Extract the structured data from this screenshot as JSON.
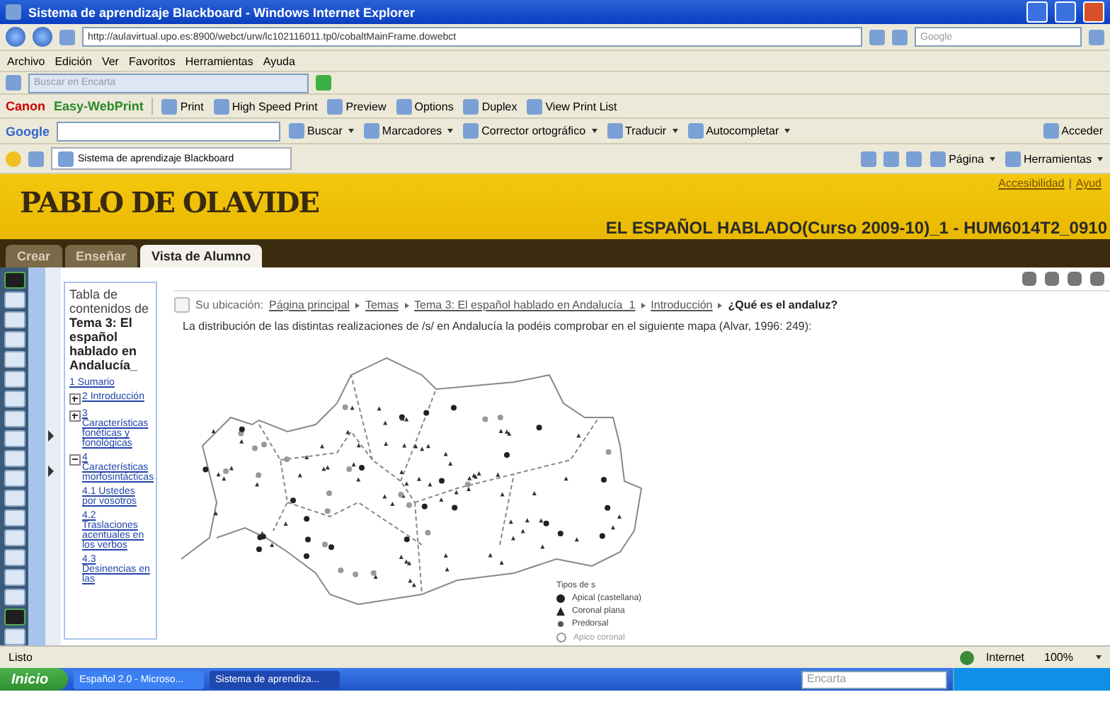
{
  "window": {
    "title": "Sistema de aprendizaje Blackboard - Windows Internet Explorer"
  },
  "address_bar": {
    "url": "http://aulavirtual.upo.es:8900/webct/urw/lc102116011.tp0/cobaltMainFrame.dowebct",
    "search_placeholder": "Google"
  },
  "menu": [
    "Archivo",
    "Edición",
    "Ver",
    "Favoritos",
    "Herramientas",
    "Ayuda"
  ],
  "encarta_toolbar": {
    "placeholder": "Buscar en Encarta"
  },
  "canon_toolbar": {
    "brand": "Canon",
    "product": "Easy-WebPrint",
    "buttons": [
      "Print",
      "High Speed Print",
      "Preview",
      "Options",
      "Duplex",
      "View Print List"
    ]
  },
  "google_toolbar": {
    "logo": "Google",
    "buttons": [
      "Buscar",
      "Marcadores",
      "Corrector ortográfico",
      "Traducir",
      "Autocompletar"
    ],
    "sign_in": "Acceder"
  },
  "browser_tab": {
    "title": "Sistema de aprendizaje Blackboard"
  },
  "command_bar": [
    "Página",
    "Herramientas"
  ],
  "header": {
    "logo": "PABLO DE OLAVIDE",
    "links": [
      "Accesibilidad",
      "Ayud"
    ],
    "separator": "|",
    "course_title": "EL ESPAÑOL HABLADO(Curso 2009-10)_1 - HUM6014T2_0910"
  },
  "course_tabs": [
    {
      "label": "Crear",
      "selected": false
    },
    {
      "label": "Enseñar",
      "selected": false
    },
    {
      "label": "Vista de Alumno",
      "selected": true
    }
  ],
  "toc": {
    "heading": "Tabla de contenidos de",
    "title": "Tema 3: El español hablado en Andalucía_",
    "items": [
      {
        "label": "1 Sumario"
      },
      {
        "label": "2 Introducción",
        "expanded": false
      },
      {
        "label": "3 Características fonéticas y fonológicas",
        "expanded": false
      },
      {
        "label": "4 Características morfosintácticas",
        "expanded": true,
        "children": [
          {
            "label": "4.1 Ustedes por vosotros"
          },
          {
            "label": "4.2 Traslaciones acentuales en los verbos"
          },
          {
            "label": "4.3 Desinencias en las"
          }
        ]
      }
    ]
  },
  "breadcrumb": {
    "label": "Su ubicación:",
    "links": [
      "Página principal",
      "Temas",
      "Tema 3: El español hablado en Andalucía_1",
      "Introducción"
    ],
    "current": "¿Qué es el andaluz?"
  },
  "body_text": "La distribución de las distintas realizaciones de /s/ en Andalucía la podéis comprobar en el siguiente mapa (Alvar, 1996: 249):",
  "map_legend": {
    "title": "Tipos de s",
    "items": [
      {
        "kind": "apical",
        "label": "Apical (castellana)"
      },
      {
        "kind": "coronal",
        "label": "Coronal plana"
      },
      {
        "kind": "predorsal",
        "label": "Predorsal"
      },
      {
        "kind": "apicocoronal",
        "label": "Apico coronal"
      }
    ]
  },
  "status_bar": {
    "text": "Listo",
    "zone": "Internet",
    "zoom": "100%"
  },
  "taskbar": {
    "start": "Inicio",
    "windows": [
      {
        "title": "Español 2.0 - Microso...",
        "selected": false
      },
      {
        "title": "Sistema de aprendiza...",
        "selected": true
      }
    ],
    "search_placeholder": "Encarta"
  }
}
